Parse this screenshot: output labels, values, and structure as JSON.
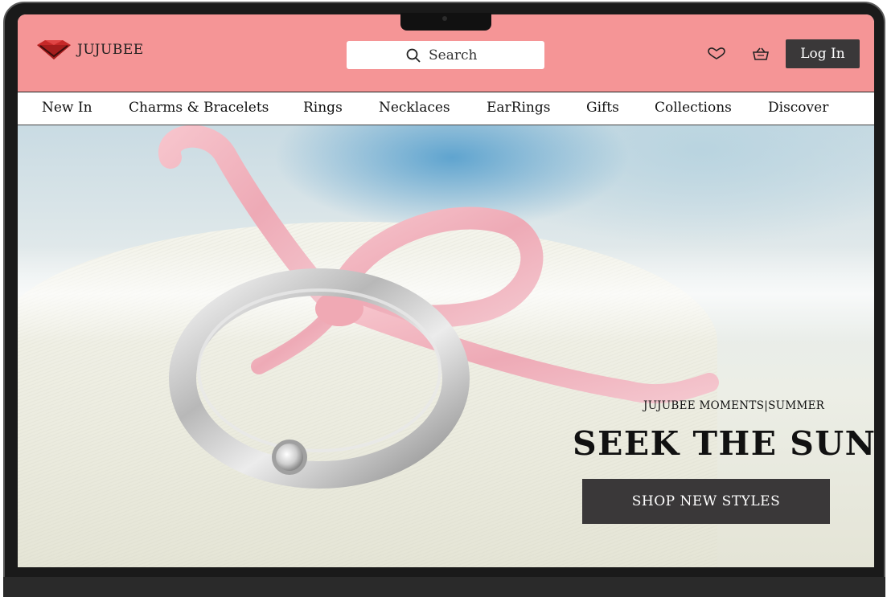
{
  "brand": {
    "name": "JUJUBEE",
    "accent_color": "#f59596",
    "logo_icon": "diamond-icon"
  },
  "header": {
    "search_placeholder": "Search",
    "search_icon": "search-icon",
    "wishlist_icon": "heart-icon",
    "cart_icon": "basket-icon",
    "login_label": "Log In"
  },
  "nav": {
    "items": [
      {
        "label": "New In"
      },
      {
        "label": "Charms & Bracelets"
      },
      {
        "label": "Rings"
      },
      {
        "label": "Necklaces"
      },
      {
        "label": "EarRings"
      },
      {
        "label": "Gifts"
      },
      {
        "label": "Collections"
      },
      {
        "label": "Discover"
      }
    ]
  },
  "hero": {
    "eyebrow": "JUJUBEE MOMENTS|SUMMER",
    "title": "SEEK THE SUN",
    "cta_label": "SHOP NEW STYLES"
  }
}
